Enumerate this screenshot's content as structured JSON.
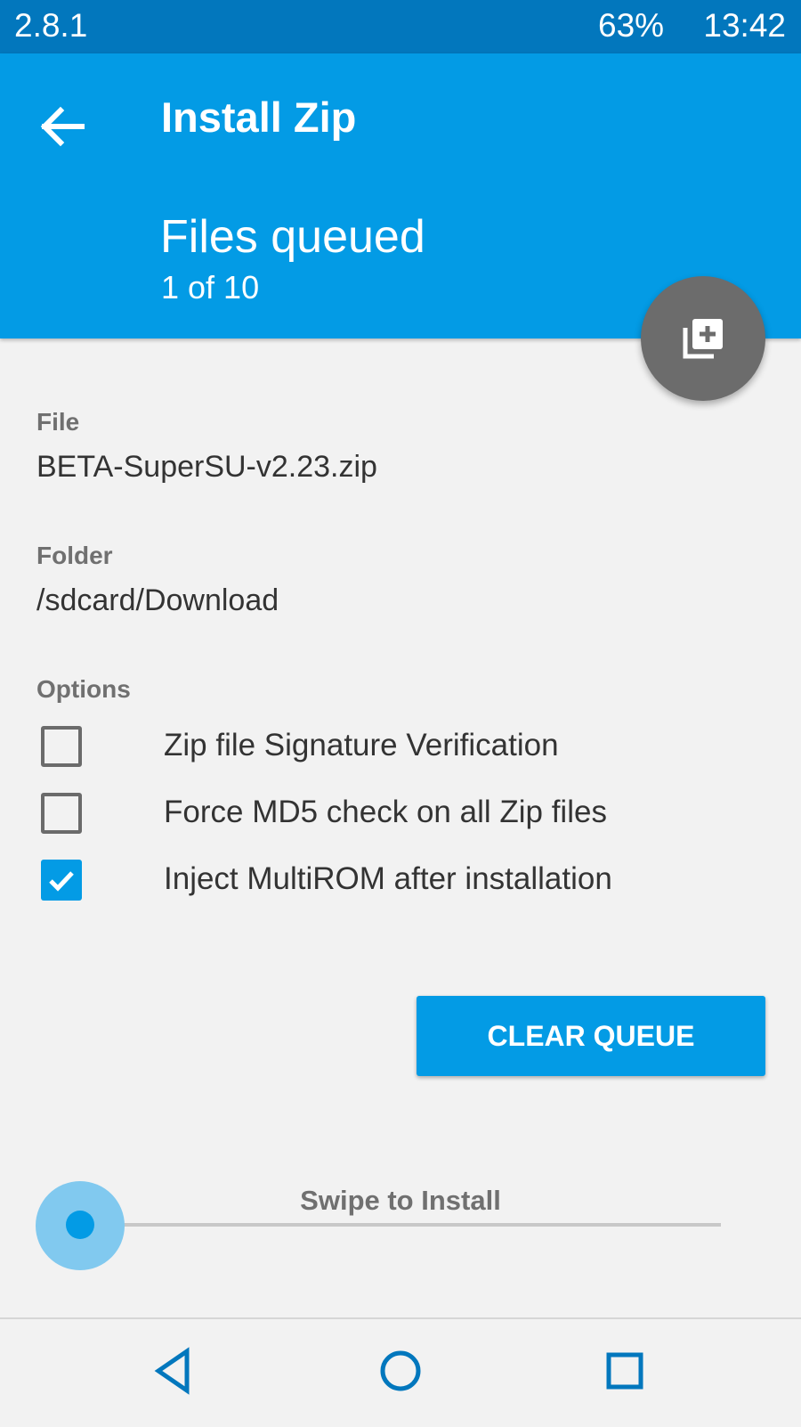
{
  "status_bar": {
    "version": "2.8.1",
    "battery": "63%",
    "time": "13:42"
  },
  "header": {
    "back_icon": "arrow-left-icon",
    "title": "Install Zip",
    "subtitle": "Files queued",
    "count": "1 of 10",
    "accent_color": "#039be5",
    "status_color": "#0277bd"
  },
  "fab": {
    "icon": "add-to-queue-icon",
    "color": "#6c6c6c"
  },
  "file": {
    "label": "File",
    "value": "BETA-SuperSU-v2.23.zip"
  },
  "folder": {
    "label": "Folder",
    "value": "/sdcard/Download"
  },
  "options": {
    "label": "Options",
    "items": [
      {
        "label": "Zip file Signature Verification",
        "checked": false
      },
      {
        "label": "Force MD5 check on all Zip files",
        "checked": false
      },
      {
        "label": "Inject MultiROM after installation",
        "checked": true
      }
    ]
  },
  "clear_button": {
    "label": "CLEAR QUEUE"
  },
  "swipe": {
    "label": "Swipe to Install",
    "progress": 0
  },
  "nav": {
    "back": "back-triangle-icon",
    "home": "home-circle-icon",
    "recents": "recents-square-icon"
  }
}
